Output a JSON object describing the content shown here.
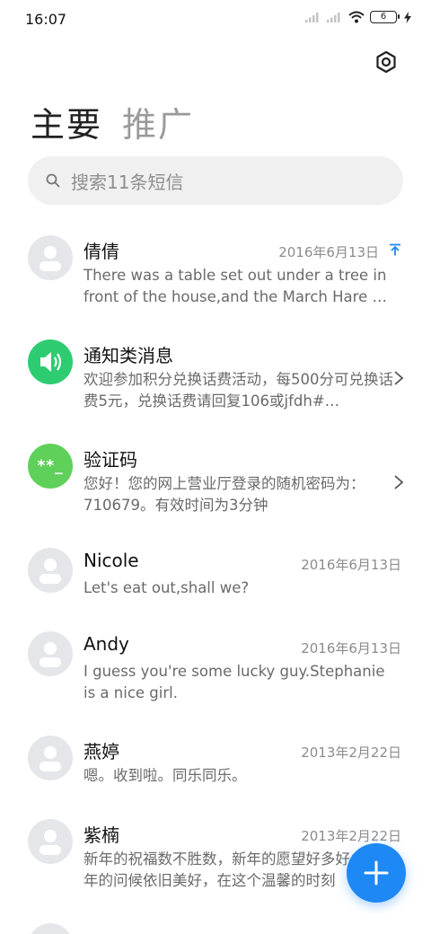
{
  "status_bar": {
    "time": "16:07",
    "battery": "6"
  },
  "header": {
    "tabs": [
      {
        "label": "主要",
        "active": true
      },
      {
        "label": "推广",
        "active": false
      }
    ]
  },
  "search": {
    "placeholder": "搜索11条短信"
  },
  "conversations": [
    {
      "name": "倩倩",
      "date": "2016年6月13日",
      "pinned": true,
      "avatar": "person-icon",
      "preview": "There was a table set out under a tree in front of the house,and the March Hare …"
    },
    {
      "name": "通知类消息",
      "date": "",
      "avatar": "speaker-icon",
      "chevron": true,
      "preview": "欢迎参加积分兑换话费活动，每500分可兑换话费5元，兑换话费请回复106或jfdh#…"
    },
    {
      "name": "验证码",
      "date": "",
      "avatar": "password-icon",
      "avatar_text": "**_",
      "chevron": true,
      "preview": "您好！您的网上营业厅登录的随机密码为：710679。有效时间为3分钟"
    },
    {
      "name": "Nicole",
      "date": "2016年6月13日",
      "avatar": "person-icon",
      "preview": "Let's eat out,shall we?"
    },
    {
      "name": "Andy",
      "date": "2016年6月13日",
      "avatar": "person-icon",
      "preview": "I guess you're some lucky guy.Stephanie is a nice girl."
    },
    {
      "name": "燕婷",
      "date": "2013年2月22日",
      "avatar": "person-icon",
      "preview": "嗯。收到啦。同乐同乐。"
    },
    {
      "name": "紫楠",
      "date": "2013年2月22日",
      "avatar": "person-icon",
      "preview": "新年的祝福数不胜数，新年的愿望好多好多，新年的问候依旧美好，在这个温馨的时刻"
    }
  ],
  "colors": {
    "accent": "#1e88f5",
    "notify_green": "#2ecc71",
    "code_green": "#5fd15a"
  }
}
